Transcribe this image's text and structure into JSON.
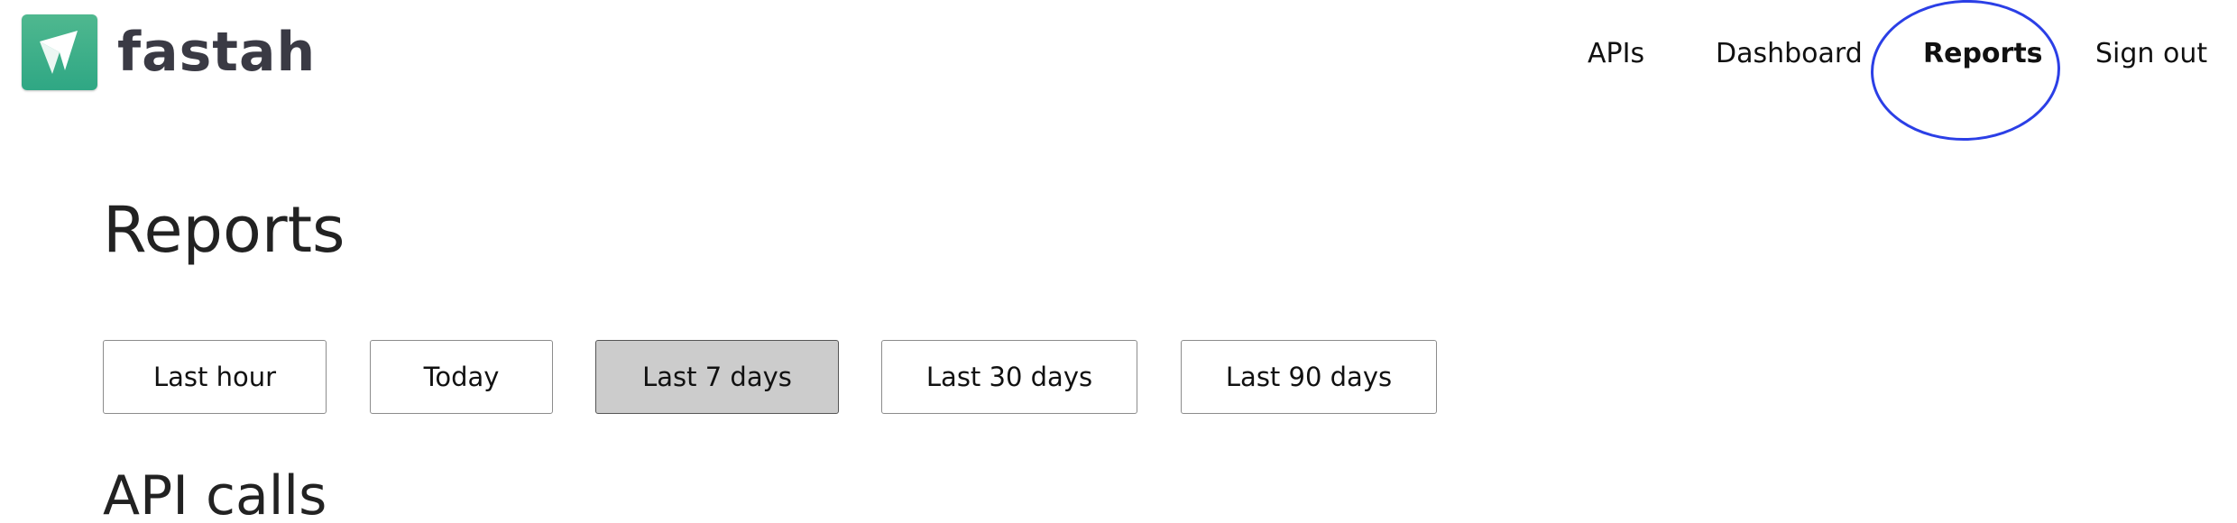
{
  "brand": {
    "name": "fastah",
    "logo_icon": "fastah-logo-icon",
    "logo_color": "#3aac86"
  },
  "nav": {
    "items": [
      {
        "label": "APIs"
      },
      {
        "label": "Dashboard"
      },
      {
        "label": "Reports",
        "active": true
      },
      {
        "label": "Sign out"
      }
    ],
    "highlight_color": "#2b3fe6"
  },
  "main": {
    "title": "Reports",
    "ranges": [
      {
        "label": "Last hour"
      },
      {
        "label": "Today"
      },
      {
        "label": "Last 7 days",
        "selected": true
      },
      {
        "label": "Last 30 days"
      },
      {
        "label": "Last 90 days"
      }
    ],
    "section_title": "API calls"
  }
}
